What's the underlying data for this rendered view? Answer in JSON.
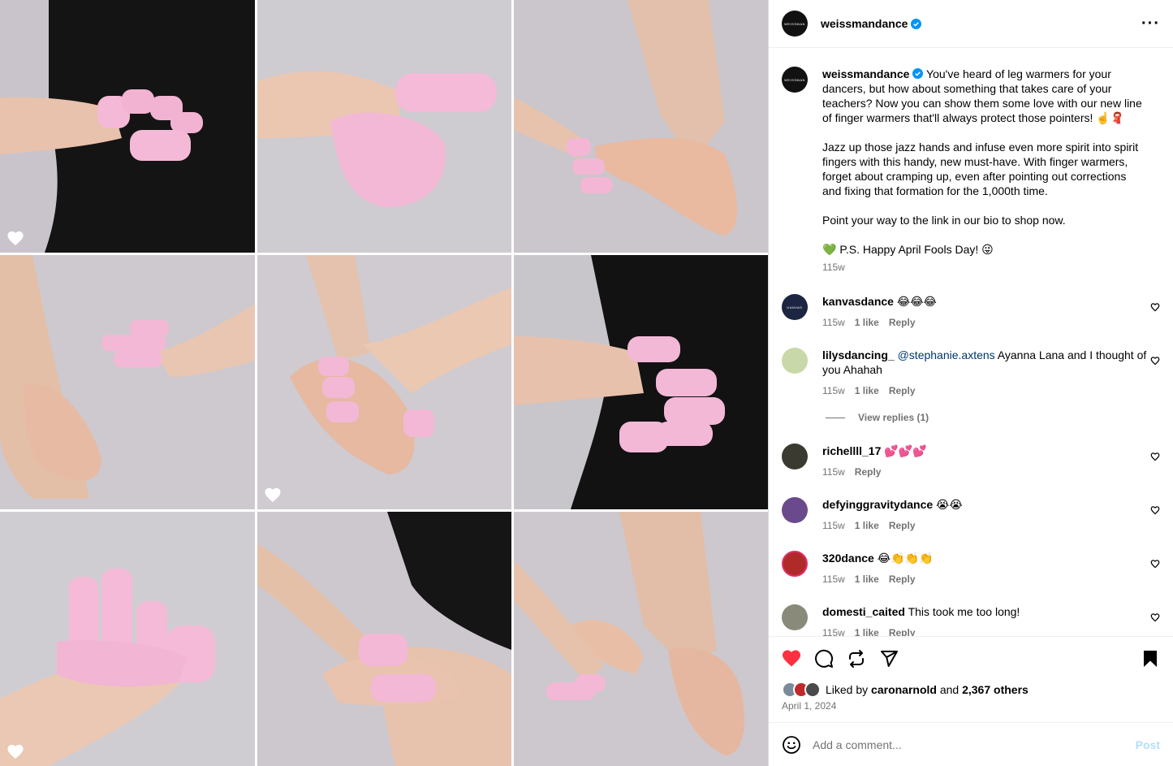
{
  "post": {
    "author": "weissmandance",
    "avatar_text": "WEISSMAN",
    "caption_paragraphs": [
      "You've heard of leg warmers for your dancers, but how about something that takes care of your teachers? Now you can show them some love with our new line of finger warmers that'll always protect those pointers! ☝️🧣",
      "Jazz up those jazz hands and infuse even more spirit into spirit fingers with this handy, new must-have. With finger warmers, forget about cramping up, even after pointing out corrections and fixing that formation for the 1,000th time.",
      "Point your way to the link in our bio to shop now.",
      "💚 P.S. Happy April Fools Day! 😜"
    ],
    "caption_time": "115w",
    "liked_by_user": "caronarnold",
    "liked_by_prefix": "Liked by",
    "liked_by_and": "and",
    "liked_by_others": "2,367 others",
    "date": "April 1, 2024",
    "more_icon": "more-horizontal-icon"
  },
  "comments": [
    {
      "user": "kanvasdance",
      "text": "😂😂😂",
      "time": "115w",
      "likes": "1 like",
      "reply": "Reply",
      "avatar_text": "KANVAS",
      "avatar_color": "#1c2541"
    },
    {
      "user": "lilysdancing_",
      "mention": "@stephanie.axtens",
      "text": "Ayanna Lana and I thought of you Ahahah",
      "time": "115w",
      "likes": "1 like",
      "reply": "Reply",
      "avatar_color": "#c8d8a8"
    },
    {
      "user": "richellll_17",
      "text": "💕💕💕",
      "time": "115w",
      "reply": "Reply",
      "avatar_color": "#3a3a30"
    },
    {
      "user": "defyinggravitydance",
      "text": "😭😭",
      "time": "115w",
      "likes": "1 like",
      "reply": "Reply",
      "avatar_color": "#6a4a8c"
    },
    {
      "user": "320dance",
      "text": "😂👏👏👏",
      "time": "115w",
      "likes": "1 like",
      "reply": "Reply",
      "avatar_color": "#b02a2a"
    },
    {
      "user": "domesti_caited",
      "text": "This took me too long!",
      "time": "115w",
      "likes": "1 like",
      "reply": "Reply",
      "avatar_color": "#8a8a7a"
    }
  ],
  "view_replies": "View replies (1)",
  "add_comment": {
    "placeholder": "Add a comment...",
    "post_label": "Post"
  },
  "icons": {
    "like": "heart-filled-icon",
    "comment": "comment-icon",
    "share": "repost-icon",
    "send": "send-icon",
    "save": "bookmark-filled-icon",
    "emoji": "emoji-icon"
  },
  "colors": {
    "like_red": "#ff3040",
    "link_blue": "#00376b",
    "post_disabled": "#b2dffc",
    "verified_blue": "#0095f6"
  }
}
